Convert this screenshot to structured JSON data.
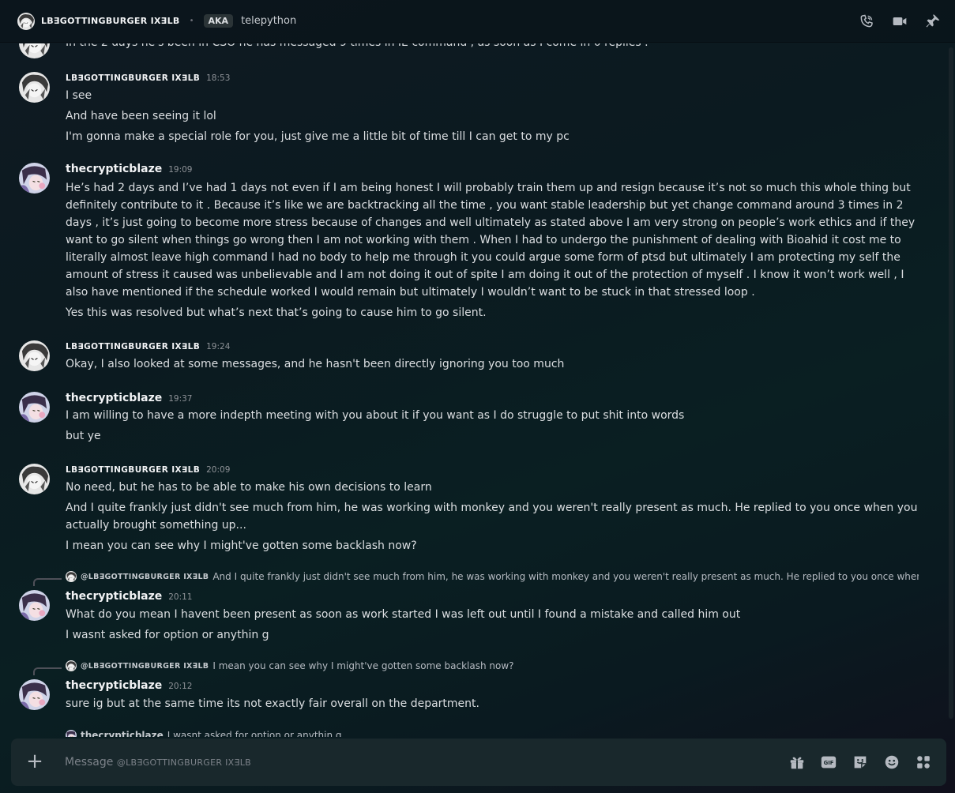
{
  "header": {
    "username": "LB∃GOTTINGBURGER IX∃LB",
    "aka_badge": "AKA",
    "aka_name": "telepython",
    "icons": [
      "voice-call-icon",
      "video-call-icon",
      "pin-icon"
    ]
  },
  "chat": {
    "partial_top_line": "In the 2 days he's been in CSO he has messaged 9 times in IE command , as soon as I come in 0 replies .",
    "groups": [
      {
        "author": "LB∃GOTTINGBURGER IX∃LB",
        "time": "18:53",
        "lines": [
          "I see",
          "And have been seeing it lol",
          "I'm gonna make a special role for you, just give me a little bit of time till I can get to my pc"
        ]
      },
      {
        "author": "thecrypticblaze",
        "time": "19:09",
        "lines": [
          "He’s had 2 days and I’ve had 1 days not even if I am being honest I will probably train them up and resign because it’s not so much this whole thing but definitely contribute to it . Because it’s like we are backtracking all the time , you want stable leadership but yet change command around 3 times in 2 days , it’s just going to become more stress because of changes and well ultimately as stated above I am very strong on people’s work ethics and if they want to go silent when things go wrong then I am not working with them .  When I had to undergo the punishment of dealing with Bioahid it cost me to literally almost leave high command  I had no body to help me through it you could argue some form of ptsd but ultimately I am protecting my self the amount of stress it caused was unbelievable and I am not doing it out of spite I am doing it out of the protection of myself . I know it won’t work well , I also have mentioned if the schedule worked I would remain but ultimately I wouldn’t want to be stuck in that stressed loop .",
          "Yes this was resolved but what’s next that’s going to cause him to go silent."
        ]
      },
      {
        "author": "LB∃GOTTINGBURGER IX∃LB",
        "time": "19:24",
        "lines": [
          "Okay, I also looked at some messages, and he hasn't been directly ignoring you too much"
        ]
      },
      {
        "author": "thecrypticblaze",
        "time": "19:37",
        "lines": [
          "I am willing to have a more indepth meeting with you about it if you want as I do struggle to put shit into words",
          "but ye"
        ]
      },
      {
        "author": "LB∃GOTTINGBURGER IX∃LB",
        "time": "20:09",
        "lines": [
          "No need, but he has to be able to make his own decisions to learn",
          "And I quite frankly just didn't see much from him, he was working with monkey and you weren't really present as much. He replied to you once when you actually brought something up...",
          "I mean you can see why I might've gotten some backlash now?"
        ]
      },
      {
        "reply_to": {
          "author": "@LB∃GOTTINGBURGER IX∃LB",
          "text": "And I quite frankly just didn't see much from him, he was working with monkey and you weren't really present as much. He replied to you once when yo..."
        },
        "author": "thecrypticblaze",
        "time": "20:11",
        "lines": [
          "What do you mean I havent been present as soon as work started I was left out until I found a mistake and called him out",
          "I wasnt asked for option or anythin g"
        ]
      },
      {
        "reply_to": {
          "author": "@LB∃GOTTINGBURGER IX∃LB",
          "text": "I mean you can see why I might've gotten some backlash now?"
        },
        "author": "thecrypticblaze",
        "time": "20:12",
        "lines": [
          "sure ig but at the same time its not exactly fair overall on the department."
        ]
      }
    ],
    "partial_bottom_reply": {
      "author": "thecrypticblaze",
      "text": "I wasnt asked for option or anythin g"
    }
  },
  "composer": {
    "placeholder_prefix": "Message ",
    "placeholder_name": "@LB∃GOTTINGBURGER IX∃LB",
    "icons": [
      "add-icon",
      "gift-icon",
      "gif-icon",
      "sticker-icon",
      "emoji-icon",
      "apps-icon"
    ]
  }
}
